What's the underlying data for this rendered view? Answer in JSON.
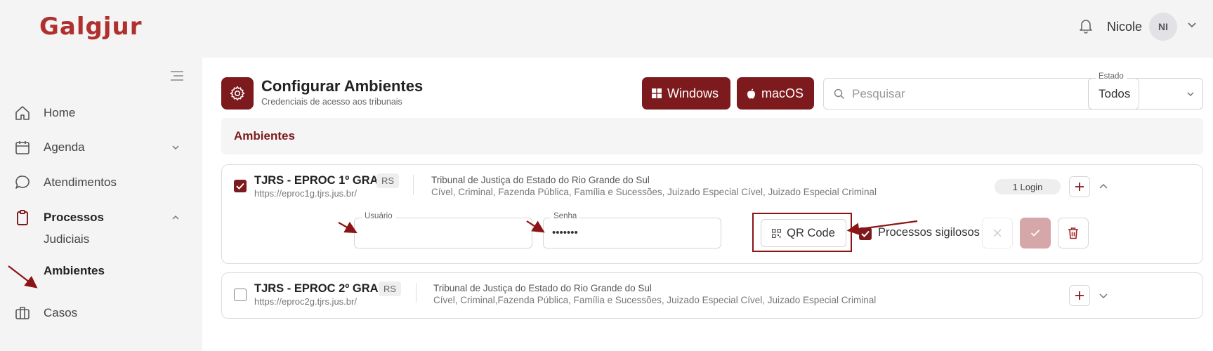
{
  "brand": {
    "logo_text": "Galgjur",
    "color": "#b0302e"
  },
  "header": {
    "user_name": "Nicole",
    "avatar_initials": "NI",
    "icons": [
      "bell-icon",
      "chevron-down-icon"
    ]
  },
  "sidebar": {
    "items": [
      {
        "label": "Home",
        "icon": "home-icon"
      },
      {
        "label": "Agenda",
        "icon": "calendar-icon",
        "expandable": true
      },
      {
        "label": "Atendimentos",
        "icon": "chat-bubble-icon"
      },
      {
        "label": "Processos",
        "icon": "clipboard-icon",
        "expanded": true,
        "active": true
      },
      {
        "label": "Casos",
        "icon": "briefcase-icon"
      }
    ],
    "subitems": [
      {
        "label": "Judiciais"
      },
      {
        "label": "Ambientes",
        "active": true
      }
    ]
  },
  "page": {
    "title": "Configurar Ambientes",
    "subtitle": "Credenciais de acesso aos tribunais",
    "icon": "gear-icon",
    "accent_color": "#7d1a1d"
  },
  "toolbar": {
    "windows_label": "Windows",
    "macos_label": "macOS",
    "search_placeholder": "Pesquisar",
    "estado_label": "Estado",
    "estado_value": "Todos"
  },
  "section": {
    "title": "Ambientes"
  },
  "environments": [
    {
      "name": "TJRS - EPROC 1º GRAU",
      "state": "RS",
      "url": "https://eproc1g.tjrs.jus.br/",
      "court": "Tribunal de Justiça do Estado do Rio Grande do Sul",
      "areas": "Cível, Criminal, Fazenda Pública, Família e Sucessões, Juizado Especial Cível, Juizado Especial Criminal",
      "checked": true,
      "expanded": true,
      "login_count": "1 Login",
      "form": {
        "usuario_label": "Usuário",
        "usuario_value": "",
        "senha_label": "Senha",
        "senha_value": "•••••••",
        "qr_label": "QR Code",
        "sigilosos_label": "Processos sigilosos",
        "sigilosos_checked": true
      }
    },
    {
      "name": "TJRS - EPROC 2º GRAU",
      "state": "RS",
      "url": "https://eproc2g.tjrs.jus.br/",
      "court": "Tribunal de Justiça do Estado do Rio Grande do Sul",
      "areas": "Cível, Criminal,Fazenda Pública, Família e Sucessões, Juizado Especial Cível, Juizado Especial Criminal",
      "checked": false,
      "expanded": false
    }
  ],
  "annotations": {
    "arrow_color": "#8c1414"
  }
}
